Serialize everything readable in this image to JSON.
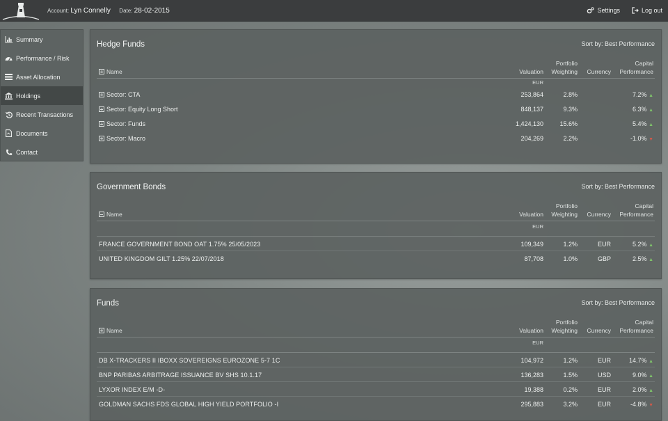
{
  "header": {
    "account_label": "Account:",
    "account_name": "Lyn Connelly",
    "date_label": "Date:",
    "date_value": "28-02-2015",
    "settings_label": "Settings",
    "logout_label": "Log out"
  },
  "sidebar": {
    "items": [
      {
        "label": "Summary",
        "icon": "bar-chart-icon"
      },
      {
        "label": "Performance / Risk",
        "icon": "gauge-icon"
      },
      {
        "label": "Asset Allocation",
        "icon": "list-icon"
      },
      {
        "label": "Holdings",
        "icon": "bank-icon"
      },
      {
        "label": "Recent Transactions",
        "icon": "history-icon"
      },
      {
        "label": "Documents",
        "icon": "document-icon"
      },
      {
        "label": "Contact",
        "icon": "phone-icon"
      }
    ],
    "active": "Holdings"
  },
  "columns": {
    "name": "Name",
    "valuation": "Valuation",
    "portfolio_1": "Portfolio",
    "portfolio_2": "Weighting",
    "currency": "Currency",
    "capital_1": "Capital",
    "capital_2": "Performance",
    "units": "EUR"
  },
  "sort_label": "Sort by: Best Performance",
  "hedge": {
    "title": "Hedge Funds",
    "rows": [
      {
        "name": "Sector: CTA",
        "valuation": "253,864",
        "weighting": "2.8%",
        "currency": "",
        "performance": "7.2%",
        "dir": "up"
      },
      {
        "name": "Sector: Equity Long Short",
        "valuation": "848,137",
        "weighting": "9.3%",
        "currency": "",
        "performance": "6.3%",
        "dir": "up"
      },
      {
        "name": "Sector: Funds",
        "valuation": "1,424,130",
        "weighting": "15.6%",
        "currency": "",
        "performance": "5.4%",
        "dir": "up"
      },
      {
        "name": "Sector: Macro",
        "valuation": "204,269",
        "weighting": "2.2%",
        "currency": "",
        "performance": "-1.0%",
        "dir": "down"
      }
    ]
  },
  "bonds": {
    "title": "Government Bonds",
    "rows": [
      {
        "name": "FRANCE GOVERNMENT BOND OAT 1.75% 25/05/2023",
        "valuation": "109,349",
        "weighting": "1.2%",
        "currency": "EUR",
        "performance": "5.2%",
        "dir": "up"
      },
      {
        "name": "UNITED KINGDOM GILT 1.25% 22/07/2018",
        "valuation": "87,708",
        "weighting": "1.0%",
        "currency": "GBP",
        "performance": "2.5%",
        "dir": "up"
      }
    ]
  },
  "funds": {
    "title": "Funds",
    "rows": [
      {
        "name": "DB X-TRACKERS II IBOXX SOVEREIGNS EUROZONE 5-7 1C",
        "valuation": "104,972",
        "weighting": "1.2%",
        "currency": "EUR",
        "performance": "14.7%",
        "dir": "up"
      },
      {
        "name": "BNP PARIBAS ARBITRAGE ISSUANCE BV SHS 10.1.17",
        "valuation": "136,283",
        "weighting": "1.5%",
        "currency": "USD",
        "performance": "9.0%",
        "dir": "up"
      },
      {
        "name": "LYXOR INDEX E/M -D-",
        "valuation": "19,388",
        "weighting": "0.2%",
        "currency": "EUR",
        "performance": "2.0%",
        "dir": "up"
      },
      {
        "name": "GOLDMAN SACHS FDS GLOBAL HIGH YIELD PORTFOLIO -I",
        "valuation": "295,883",
        "weighting": "3.2%",
        "currency": "EUR",
        "performance": "-4.8%",
        "dir": "down"
      }
    ]
  },
  "colors": {
    "up": "#7fc36b",
    "down": "#d35a4a",
    "topbar": "#3b3d3e",
    "active_nav": "#434847"
  }
}
